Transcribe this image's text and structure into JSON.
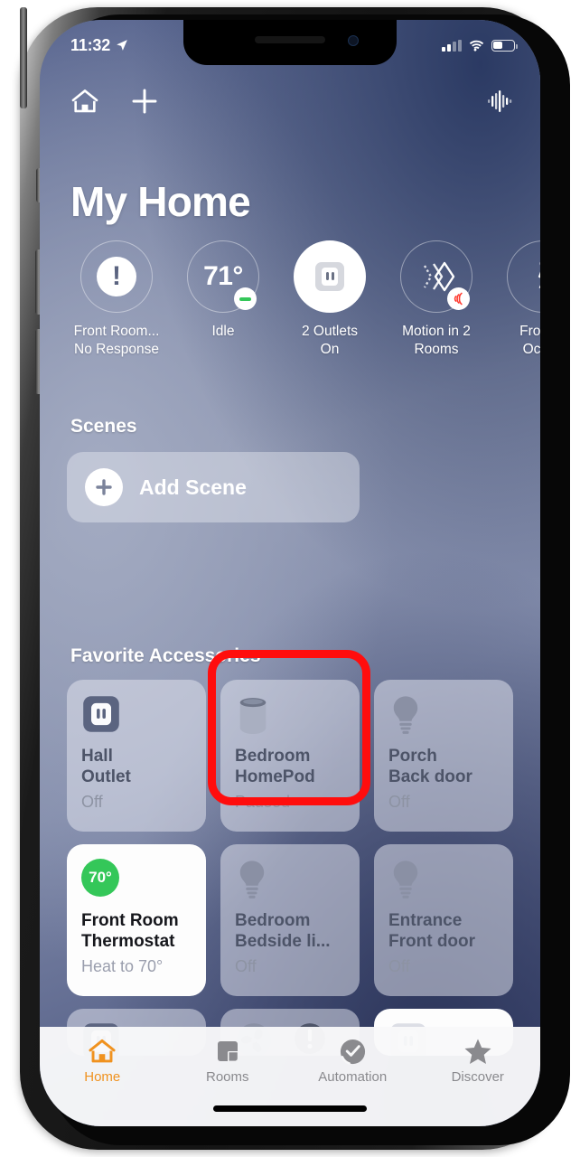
{
  "status_bar": {
    "time": "11:32",
    "location_icon": "location-arrow-icon",
    "cellular_icon": "cellular-signal-icon",
    "wifi_icon": "wifi-icon",
    "battery_icon": "battery-icon"
  },
  "nav": {
    "home_icon": "house-icon",
    "add_icon": "plus-icon",
    "siri_icon": "siri-waveform-icon"
  },
  "header": {
    "title": "My Home"
  },
  "status_widgets": [
    {
      "icon": "exclamation-circle-icon",
      "line1": "Front Room...",
      "line2": "No Response",
      "filled": false,
      "badge": "none"
    },
    {
      "icon": "temperature-value",
      "value": "71°",
      "line1": "Idle",
      "line2": "",
      "filled": false,
      "badge": "dash-green"
    },
    {
      "icon": "outlet-icon",
      "line1": "2 Outlets",
      "line2": "On",
      "filled": true,
      "badge": "none"
    },
    {
      "icon": "motion-sensor-icon",
      "line1": "Motion in 2",
      "line2": "Rooms",
      "filled": false,
      "badge": "sensor-red"
    },
    {
      "icon": "walking-person-icon",
      "line1": "Front R",
      "line2": "Occup",
      "filled": false,
      "badge": "none"
    }
  ],
  "scenes": {
    "section_title": "Scenes",
    "add_scene_label": "Add Scene",
    "add_icon": "plus-circle-icon"
  },
  "favorites": {
    "section_title": "Favorite Accessories",
    "tiles": [
      {
        "icon": "outlet-icon",
        "name_line1": "Hall",
        "name_line2": "Outlet",
        "state": "Off",
        "on": false,
        "highlighted": false
      },
      {
        "icon": "homepod-icon",
        "name_line1": "Bedroom",
        "name_line2": "HomePod",
        "state": "Paused",
        "on": false,
        "highlighted": true
      },
      {
        "icon": "lightbulb-icon",
        "name_line1": "Porch",
        "name_line2": "Back door",
        "state": "Off",
        "on": false,
        "highlighted": false
      },
      {
        "icon": "thermostat-temp-chip",
        "chip": "70°",
        "name_line1": "Front Room",
        "name_line2": "Thermostat",
        "state": "Heat to 70°",
        "on": true,
        "highlighted": false
      },
      {
        "icon": "lightbulb-icon",
        "name_line1": "Bedroom",
        "name_line2": "Bedside li...",
        "state": "Off",
        "on": false,
        "highlighted": false
      },
      {
        "icon": "lightbulb-icon",
        "name_line1": "Entrance",
        "name_line2": "Front door",
        "state": "Off",
        "on": false,
        "highlighted": false
      }
    ],
    "partial_row": [
      {
        "icon": "outlet-icon",
        "on": false
      },
      {
        "icon": "fan-icon",
        "badge": "exclamation-circle-icon",
        "on": false
      },
      {
        "icon": "outlet-icon",
        "on": true
      }
    ]
  },
  "tab_bar": {
    "tabs": [
      {
        "label": "Home",
        "icon": "house-filled-icon",
        "active": true
      },
      {
        "label": "Rooms",
        "icon": "rooms-icon",
        "active": false
      },
      {
        "label": "Automation",
        "icon": "clock-check-icon",
        "active": false
      },
      {
        "label": "Discover",
        "icon": "star-icon",
        "active": false
      }
    ],
    "active_color": "#f0921f",
    "inactive_color": "#8a8a8e"
  },
  "annotation": {
    "highlight_color": "#ff0d0d",
    "target": "Bedroom HomePod tile"
  }
}
